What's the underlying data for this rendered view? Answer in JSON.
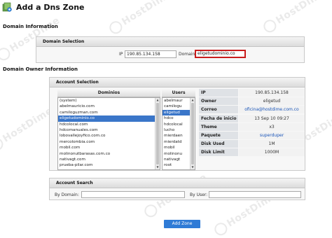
{
  "page": {
    "title": "Add a Dns Zone",
    "icon": "dns-zone-icon"
  },
  "domain_information": {
    "heading": "Domain Information",
    "box_title": "Domain Selection",
    "ip_label": "IP",
    "ip_value": "190.85.134.158",
    "domain_label": "Domain",
    "domain_value": "eligetudominio.co"
  },
  "owner_information": {
    "heading": "Domain Owner Information",
    "box_title": "Account Selection",
    "domains_header": "Dominios",
    "users_header": "Users",
    "domains": [
      "(system)",
      "abelmauricio.com",
      "camiloguzman.com",
      "eligetudominio.co",
      "hdcolocal.com",
      "hdcomanuales.com",
      "lobovallejoyfico.com.co",
      "mercolombia.com",
      "mobil.com",
      "molinonutbarasas.com.co",
      "nativagt.com",
      "prueba-pilar.com"
    ],
    "domains_selected_index": 3,
    "users": [
      "abelmaur",
      "camilogu",
      "eligetud",
      "hdco",
      "hdcolocal",
      "lucho",
      "mierdaen",
      "mierdatd",
      "mobil",
      "molinonu",
      "nativagt",
      "root"
    ],
    "users_selected_index": 2,
    "info": [
      {
        "key": "IP",
        "value": "190.85.134.158",
        "link": false
      },
      {
        "key": "Owner",
        "value": "eligetud",
        "link": false
      },
      {
        "key": "Correo electrónico",
        "value": "oficina@hostdime.com.co",
        "link": true
      },
      {
        "key": "Fecha de inicio",
        "value": "13 Sep 10 09:27",
        "link": false
      },
      {
        "key": "Theme",
        "value": "x3",
        "link": false
      },
      {
        "key": "Paquete",
        "value": "superduper",
        "link": true
      },
      {
        "key": "Disk Used",
        "value": "1M",
        "link": false
      },
      {
        "key": "Disk Limit",
        "value": "1000M",
        "link": false
      }
    ]
  },
  "account_search": {
    "box_title": "Account Search",
    "by_domain_label": "By Domain:",
    "by_domain_value": "",
    "by_user_label": "By User:",
    "by_user_value": ""
  },
  "actions": {
    "add_zone_label": "Add Zone"
  },
  "watermark": {
    "text": "HostDime"
  },
  "colors": {
    "accent_button": "#2f7bd6",
    "selected_row": "#3a76c9",
    "focus_border": "#c81c1c",
    "link": "#1a55b8"
  }
}
